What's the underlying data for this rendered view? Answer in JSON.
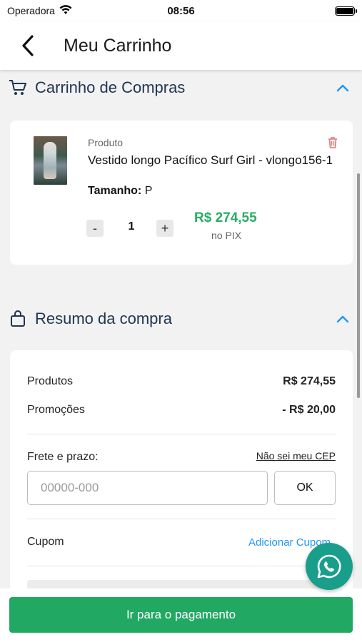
{
  "status_bar": {
    "carrier": "Operadora",
    "time": "08:56"
  },
  "header": {
    "title": "Meu Carrinho"
  },
  "cart_section": {
    "title": "Carrinho de Compras",
    "item": {
      "label": "Produto",
      "name": "Vestido longo Pacífico Surf Girl - vlongo156-1",
      "size_label": "Tamanho:",
      "size_value": "P",
      "quantity": "1",
      "minus": "-",
      "plus": "+",
      "price": "R$ 274,55",
      "price_note": "no PIX"
    }
  },
  "summary_section": {
    "title": "Resumo da compra",
    "products_label": "Produtos",
    "products_value": "R$ 274,55",
    "promotions_label": "Promoções",
    "promotions_value": "- R$ 20,00",
    "shipping_label": "Frete e prazo:",
    "unknown_cep_link": "Não sei meu CEP",
    "cep_placeholder": "00000-000",
    "ok_label": "OK",
    "coupon_label": "Cupom",
    "add_coupon_link": "Adicionar Cupom"
  },
  "footer": {
    "pay_button": "Ir para o pagamento"
  },
  "colors": {
    "accent_green": "#21a862",
    "price_green": "#27ae60",
    "link_blue": "#2196f3",
    "title_navy": "#1f3550",
    "whatsapp": "#1a9e8c"
  }
}
